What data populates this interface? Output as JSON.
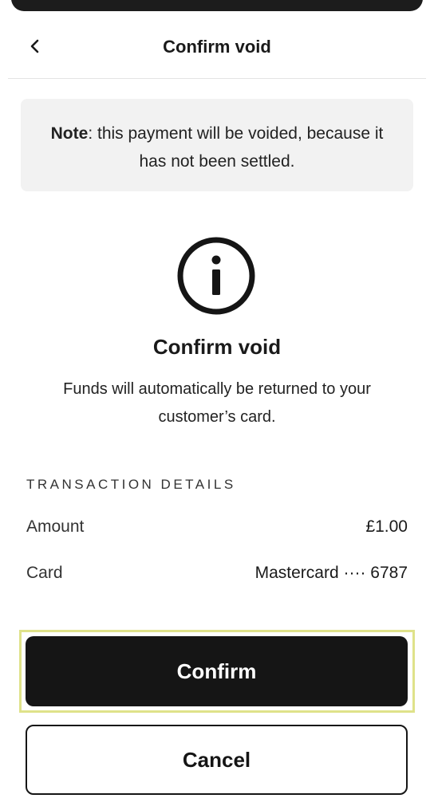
{
  "header": {
    "title": "Confirm void",
    "back_icon": "chevron-left-icon"
  },
  "note": {
    "bold": "Note",
    "text": ": this payment will be voided, because it has not been settled."
  },
  "info": {
    "icon": "info-circle-icon",
    "heading": "Confirm void",
    "description": "Funds will automatically be returned to your customer’s card."
  },
  "details": {
    "section_label": "TRANSACTION DETAILS",
    "amount_label": "Amount",
    "amount_value": "£1.00",
    "card_label": "Card",
    "card_value": "Mastercard ···· 6787"
  },
  "actions": {
    "confirm_label": "Confirm",
    "cancel_label": "Cancel"
  },
  "colors": {
    "primary_button": "#151515",
    "note_bg": "#f2f2f2",
    "highlight_border": "#dfe28a"
  }
}
